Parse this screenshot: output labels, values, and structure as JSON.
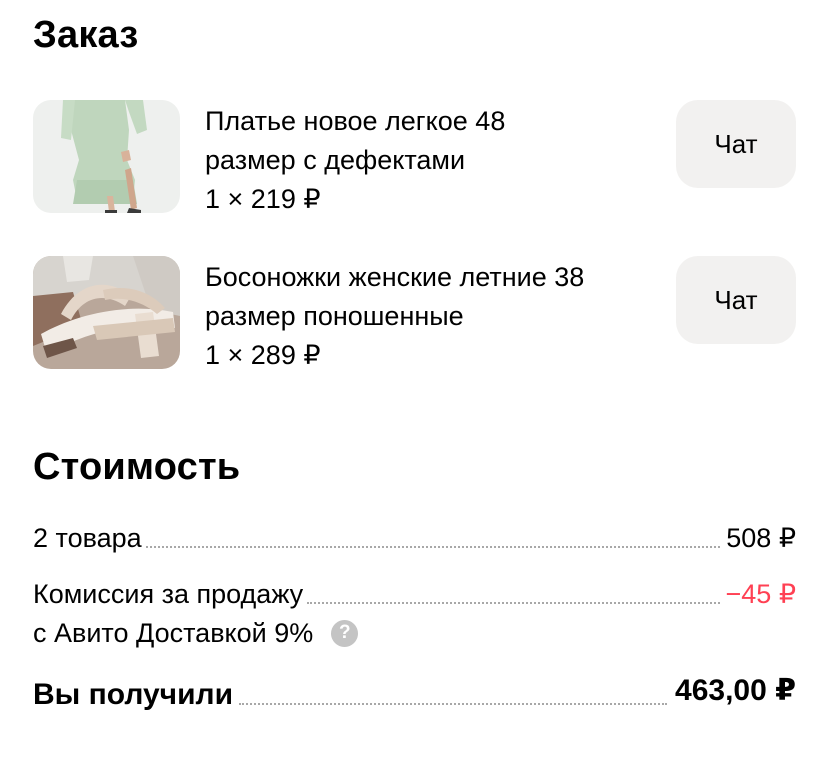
{
  "order": {
    "title": "Заказ",
    "items": [
      {
        "name_line1": "Платье новое легкое 48",
        "name_line2": "размер с дефектами",
        "price": "1 × 219 ₽",
        "chat_label": "Чат",
        "image": "dress-photo"
      },
      {
        "name_line1": "Босоножки женские летние 38",
        "name_line2": "размер поношенные",
        "price": "1 × 289 ₽",
        "chat_label": "Чат",
        "image": "sandals-photo"
      }
    ]
  },
  "cost": {
    "title": "Стоимость",
    "items_label": "2 товара",
    "items_value": "508 ₽",
    "commission_label_line1": "Комиссия за продажу",
    "commission_label_line2": "с Авито Доставкой 9%",
    "commission_value": "−45 ₽",
    "commission_color": "#ff4053",
    "help_icon": "question-icon",
    "total_label": "Вы получили",
    "total_value": "463,00 ₽"
  }
}
